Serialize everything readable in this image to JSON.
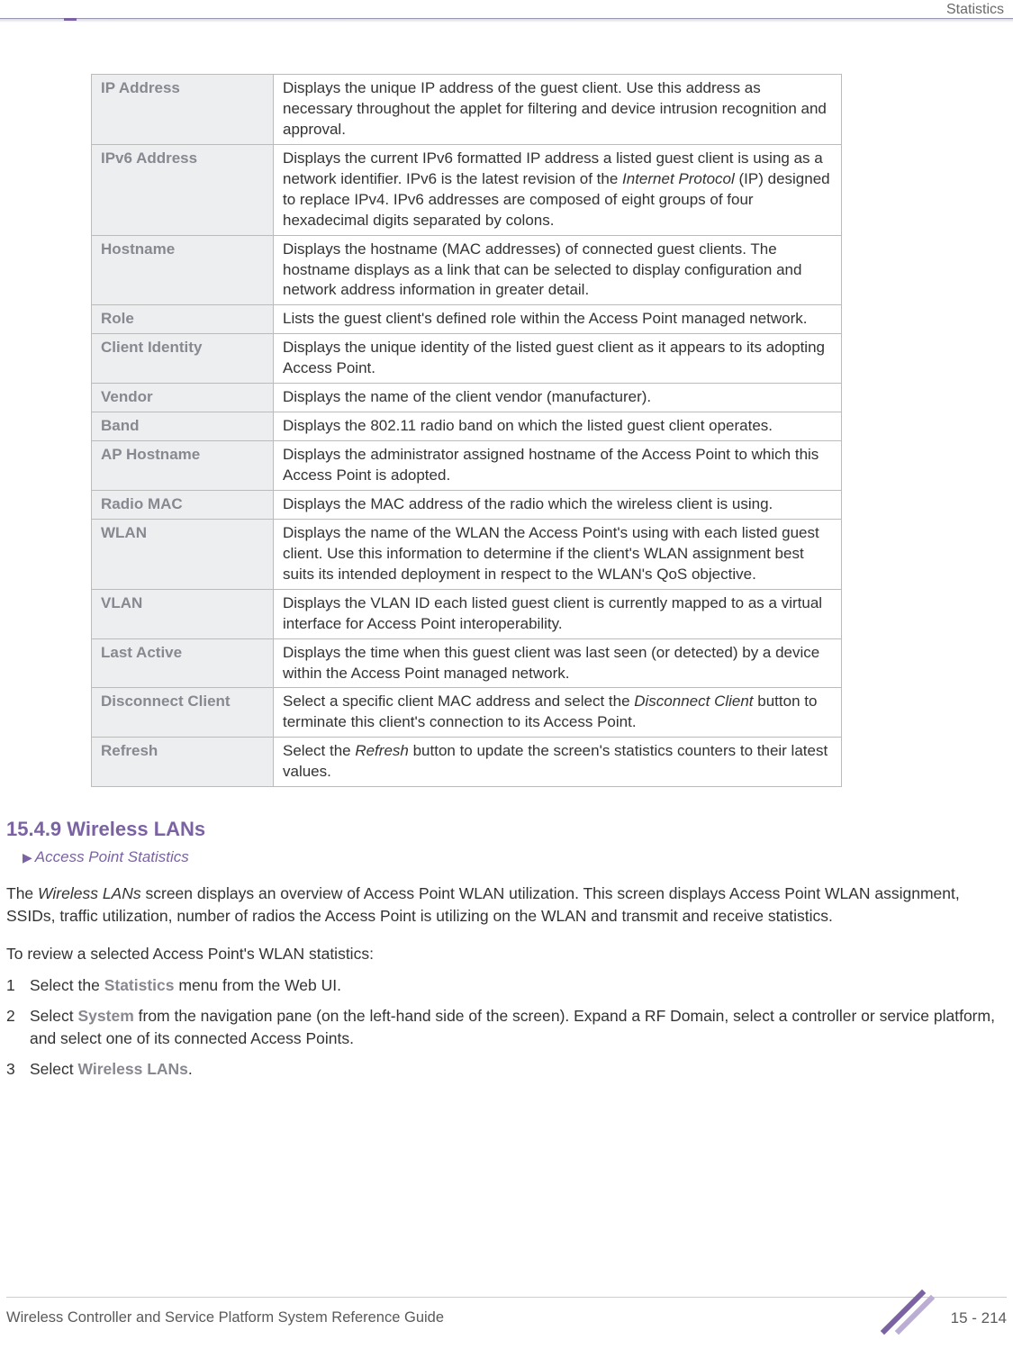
{
  "header": {
    "section_label": "Statistics"
  },
  "table": {
    "rows": [
      {
        "label": "IP Address",
        "desc": "Displays the unique IP address of the guest client. Use this address as necessary throughout the applet for filtering and device intrusion recognition and approval."
      },
      {
        "label": "IPv6 Address",
        "desc_pre": "Displays the current IPv6 formatted IP address a listed guest client is using as a network identifier. IPv6 is the latest revision of the ",
        "desc_em": "Internet Protocol",
        "desc_post": " (IP) designed to replace IPv4. IPv6 addresses are composed of eight groups of four hexadecimal digits separated by colons."
      },
      {
        "label": "Hostname",
        "desc": "Displays the hostname (MAC addresses) of connected guest clients. The hostname displays as a link that can be selected to display configuration and network address information in greater detail."
      },
      {
        "label": "Role",
        "desc": "Lists the guest client's defined role within the Access Point managed network."
      },
      {
        "label": "Client Identity",
        "desc": "Displays the unique identity of the listed guest client as it appears to its adopting Access Point."
      },
      {
        "label": "Vendor",
        "desc": "Displays the name of the client vendor (manufacturer)."
      },
      {
        "label": "Band",
        "desc": "Displays the 802.11 radio band on which the listed guest client operates."
      },
      {
        "label": "AP Hostname",
        "desc": "Displays the administrator assigned hostname of the Access Point to which this Access Point is adopted."
      },
      {
        "label": "Radio MAC",
        "desc": "Displays the MAC address of the radio which the wireless client is using."
      },
      {
        "label": "WLAN",
        "desc": "Displays the name of the WLAN the Access Point's using with each listed guest client. Use this information to determine if the client's WLAN assignment best suits its intended deployment in respect to the WLAN's QoS objective."
      },
      {
        "label": "VLAN",
        "desc": "Displays the VLAN ID each listed guest client is currently mapped to as a virtual interface for Access Point interoperability."
      },
      {
        "label": "Last Active",
        "desc": "Displays the time when this guest client was last seen (or detected) by a device within the Access Point managed network."
      },
      {
        "label": "Disconnect Client",
        "desc_pre": "Select a specific client MAC address and select the ",
        "desc_em": "Disconnect Client",
        "desc_post": " button to terminate this client's connection to its Access Point."
      },
      {
        "label": "Refresh",
        "desc_pre": "Select the ",
        "desc_em": "Refresh",
        "desc_post": " button to update the screen's statistics counters to their latest values."
      }
    ]
  },
  "section": {
    "heading": "15.4.9 Wireless LANs",
    "breadcrumb": "Access Point Statistics",
    "intro_pre": "The ",
    "intro_em": "Wireless LANs",
    "intro_post": " screen displays an overview of Access Point WLAN utilization. This screen displays Access Point WLAN assignment, SSIDs, traffic utilization, number of radios the Access Point is utilizing on the WLAN and transmit and receive statistics.",
    "lead": "To review a selected Access Point's WLAN statistics:",
    "steps": [
      {
        "num": "1",
        "pre": "Select the ",
        "kw": "Statistics",
        "post": " menu from the Web UI."
      },
      {
        "num": "2",
        "pre": "Select ",
        "kw": "System",
        "post": " from the navigation pane (on the left-hand side of the screen). Expand a RF Domain, select a controller or service platform, and select one of its connected Access Points."
      },
      {
        "num": "3",
        "pre": "Select ",
        "kw": "Wireless LANs",
        "post": "."
      }
    ]
  },
  "footer": {
    "left": "Wireless Controller and Service Platform System Reference Guide",
    "right": "15 - 214"
  }
}
